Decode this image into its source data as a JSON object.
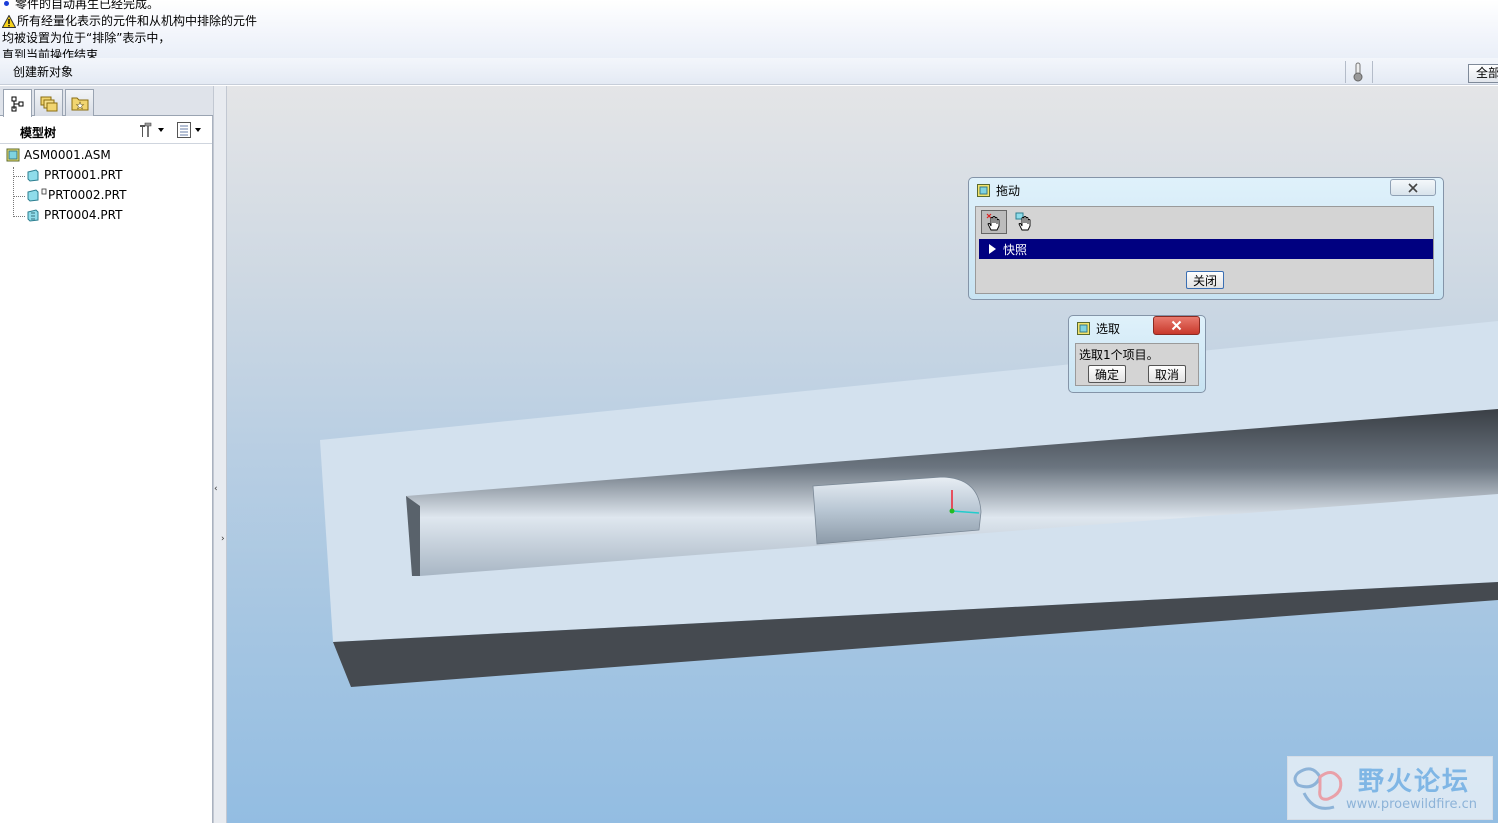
{
  "messages": [
    {
      "type": "info",
      "text": "零件的自动再生已经完成。"
    },
    {
      "type": "warning",
      "text": "所有经量化表示的元件和从机构中排除的元件"
    },
    {
      "type": "plain",
      "text": "均被设置为位于“排除”表示中，"
    },
    {
      "type": "plain",
      "text": "直到当前操作结束"
    }
  ],
  "status": {
    "text": "创建新对象",
    "filter_label": "全部"
  },
  "model_tree": {
    "title": "模型树",
    "root": "ASM0001.ASM",
    "items": [
      "PRT0001.PRT",
      "PRT0002.PRT",
      "PRT0004.PRT"
    ]
  },
  "drag_dialog": {
    "title": "拖动",
    "section": "快照",
    "close_button": "关闭"
  },
  "select_dialog": {
    "title": "选取",
    "prompt": "选取1个项目。",
    "ok_button": "确定",
    "cancel_button": "取消"
  },
  "watermark": {
    "name": "野火论坛",
    "url": "www.proewildfire.cn"
  },
  "colors": {
    "selection_bar": "#000080",
    "close_red": "#d2463a"
  }
}
